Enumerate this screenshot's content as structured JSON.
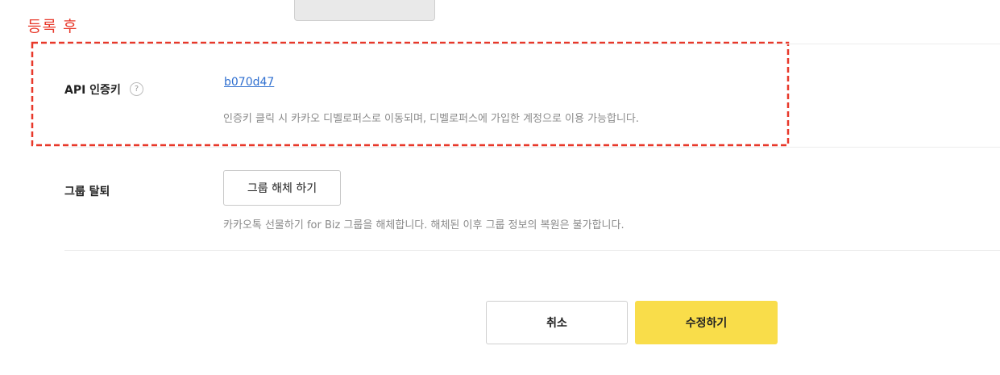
{
  "annotation": {
    "label": "등록 후",
    "color": "#e8382a"
  },
  "api_key_row": {
    "label": "API 인증키",
    "help_icon": "?",
    "key_link": "b070d47",
    "description": "인증키 클릭 시 카카오 디벨로퍼스로 이동되며, 디벨로퍼스에 가입한 계정으로 이용 가능합니다."
  },
  "group_leave_row": {
    "label": "그룹 탈퇴",
    "button_label": "그룹 해체 하기",
    "description": "카카오톡 선물하기 for Biz 그룹을 해체합니다. 해체된 이후 그룹 정보의 복원은 불가합니다."
  },
  "footer": {
    "cancel_label": "취소",
    "submit_label": "수정하기"
  },
  "colors": {
    "link": "#2f6fd0",
    "primary_button": "#f9dd4a",
    "annotation_dash": "#e8382a"
  }
}
